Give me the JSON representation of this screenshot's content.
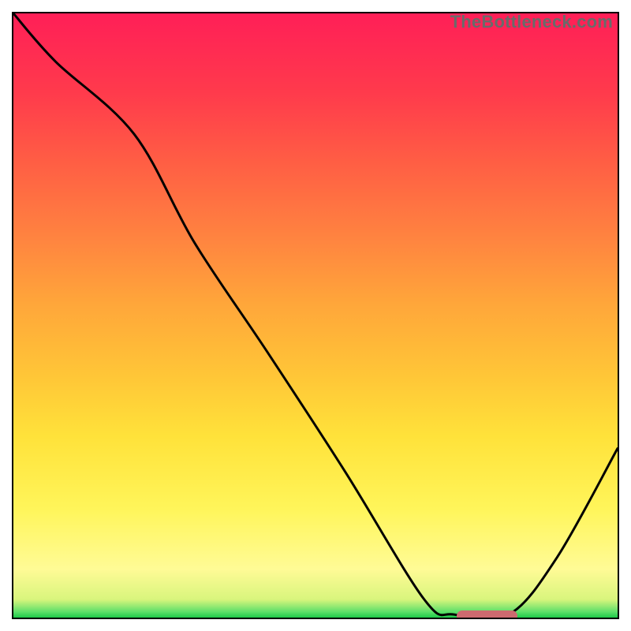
{
  "attribution": "TheBottleneck.com",
  "colors": {
    "frame": "#000000",
    "curve": "#000000",
    "pill": "#cd6a6f",
    "gradient_top": "#ff1f57",
    "gradient_bottom": "#1ec94a"
  },
  "chart_data": {
    "type": "line",
    "title": "",
    "xlabel": "",
    "ylabel": "",
    "xlim": [
      0,
      100
    ],
    "ylim": [
      0,
      100
    ],
    "grid": false,
    "series": [
      {
        "name": "bottleneck-curve",
        "color": "#000000",
        "x": [
          0,
          7,
          20,
          30,
          42,
          55,
          68,
          73,
          82,
          90,
          100
        ],
        "y": [
          100,
          92,
          80,
          62,
          44,
          24,
          3,
          0.5,
          0.5,
          10,
          28
        ]
      }
    ],
    "marker": {
      "name": "optimal-range-pill",
      "color": "#cd6a6f",
      "x_start": 73,
      "x_end": 83,
      "y": 0.8
    }
  }
}
